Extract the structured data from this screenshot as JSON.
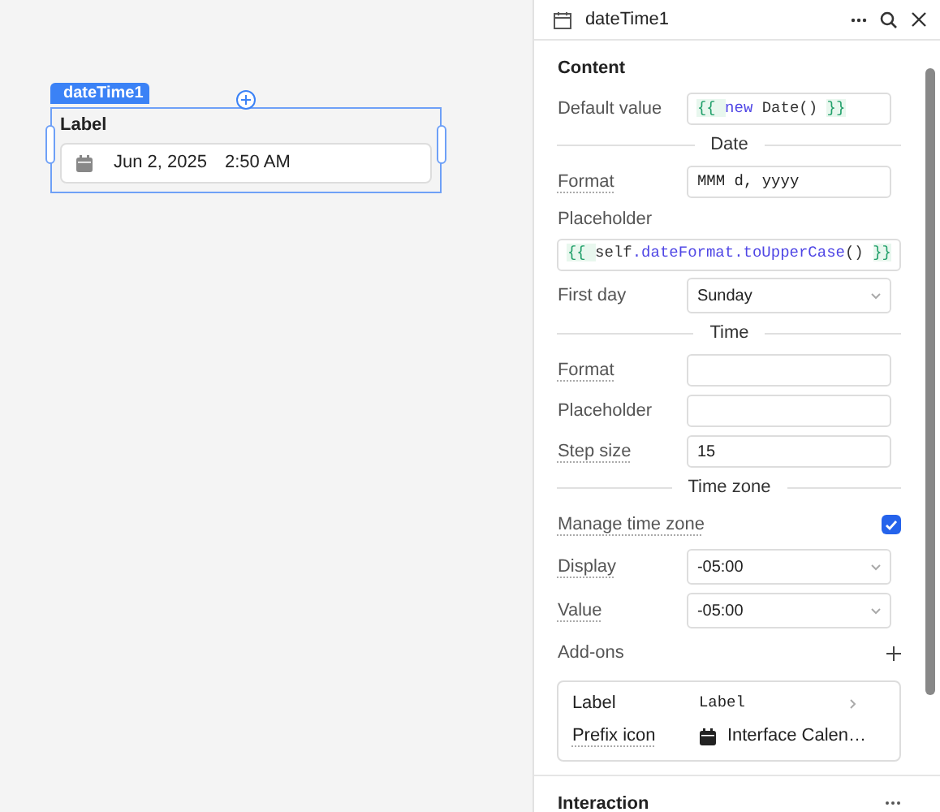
{
  "canvas": {
    "component": {
      "tag": "dateTime1",
      "label": "Label",
      "date": "Jun 2, 2025",
      "time": "2:50 AM",
      "selected": true
    }
  },
  "panel": {
    "title": "dateTime1",
    "sections": [
      {
        "title": "Content",
        "rows": [
          {
            "kind": "code",
            "label": "Default value",
            "tokens": [
              {
                "text": "{{ ",
                "color": "#22a06b"
              },
              {
                "text": "new",
                "color": "#4f46e5"
              },
              {
                "text": " Date() ",
                "color": "#333333"
              },
              {
                "text": "}}",
                "color": "#22a06b"
              }
            ]
          },
          {
            "kind": "divider",
            "label": "Date"
          },
          {
            "kind": "text",
            "label": "Format",
            "value": "MMM d, yyyy",
            "mono": true,
            "hinted": true
          },
          {
            "kind": "code-wide",
            "label": "Placeholder",
            "tokens": [
              {
                "text": "{{ ",
                "color": "#22a06b"
              },
              {
                "text": "self",
                "color": "#333333"
              },
              {
                "text": ".dateFormat.toUpperCase",
                "color": "#4f46e5"
              },
              {
                "text": "() ",
                "color": "#333333"
              },
              {
                "text": "}}",
                "color": "#22a06b"
              }
            ]
          },
          {
            "kind": "select",
            "label": "First day",
            "value": "Sunday"
          },
          {
            "kind": "divider",
            "label": "Time"
          },
          {
            "kind": "text",
            "label": "Format",
            "hinted": true
          },
          {
            "kind": "text",
            "label": "Placeholder"
          },
          {
            "kind": "text",
            "label": "Step size",
            "value": "15",
            "hinted": true
          },
          {
            "kind": "divider",
            "label": "Time zone"
          },
          {
            "kind": "checkbox",
            "label": "Manage time zone",
            "checked": true,
            "hinted": true
          },
          {
            "kind": "select",
            "label": "Display",
            "value": "-05:00",
            "hinted": true
          },
          {
            "kind": "select",
            "label": "Value",
            "value": "-05:00",
            "hinted": true
          },
          {
            "kind": "addons",
            "label": "Add-ons",
            "items": [
              {
                "label": "Label",
                "value": "Label",
                "kind": "code"
              },
              {
                "label": "Prefix icon",
                "value": "Interface Calen…",
                "kind": "icon",
                "hinted": true
              }
            ]
          }
        ]
      },
      {
        "title": "Interaction"
      }
    ]
  }
}
